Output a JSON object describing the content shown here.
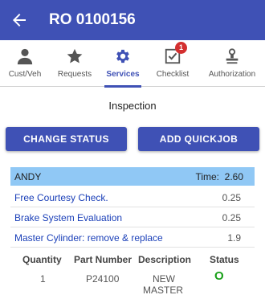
{
  "appbar": {
    "title": "RO 0100156",
    "back_icon": "arrow-left-icon"
  },
  "tabs": [
    {
      "label": "Cust/Veh",
      "icon": "person-icon",
      "active": false
    },
    {
      "label": "Requests",
      "icon": "star-icon",
      "active": false
    },
    {
      "label": "Services",
      "icon": "gear-icon",
      "active": true
    },
    {
      "label": "Checklist",
      "icon": "checkbox-icon",
      "active": false,
      "badge": "1"
    },
    {
      "label": "Authorization",
      "icon": "stamp-icon",
      "active": false
    }
  ],
  "section_title": "Inspection",
  "buttons": {
    "change_status": "CHANGE STATUS",
    "add_quickjob": "ADD QUICKJOB"
  },
  "technician": {
    "name": "ANDY",
    "time_label": "Time:",
    "time_value": "2.60"
  },
  "jobs": [
    {
      "name": "Free Courtesy Check.",
      "hours": "0.25"
    },
    {
      "name": "Brake System Evaluation",
      "hours": "0.25"
    },
    {
      "name": "Master Cylinder: remove & replace",
      "hours": "1.9"
    }
  ],
  "parts_table": {
    "headers": [
      "Quantity",
      "Part Number",
      "Description",
      "Status"
    ],
    "rows": [
      {
        "quantity": "1",
        "part_number": "P24100",
        "description_line1": "NEW",
        "description_line2": "MASTER",
        "status": "O"
      }
    ]
  },
  "colors": {
    "primary": "#3f51b5",
    "tech_row": "#90c8f5",
    "link": "#1a3fb8",
    "status_ok": "#1aa01a",
    "badge": "#d32f2f"
  }
}
